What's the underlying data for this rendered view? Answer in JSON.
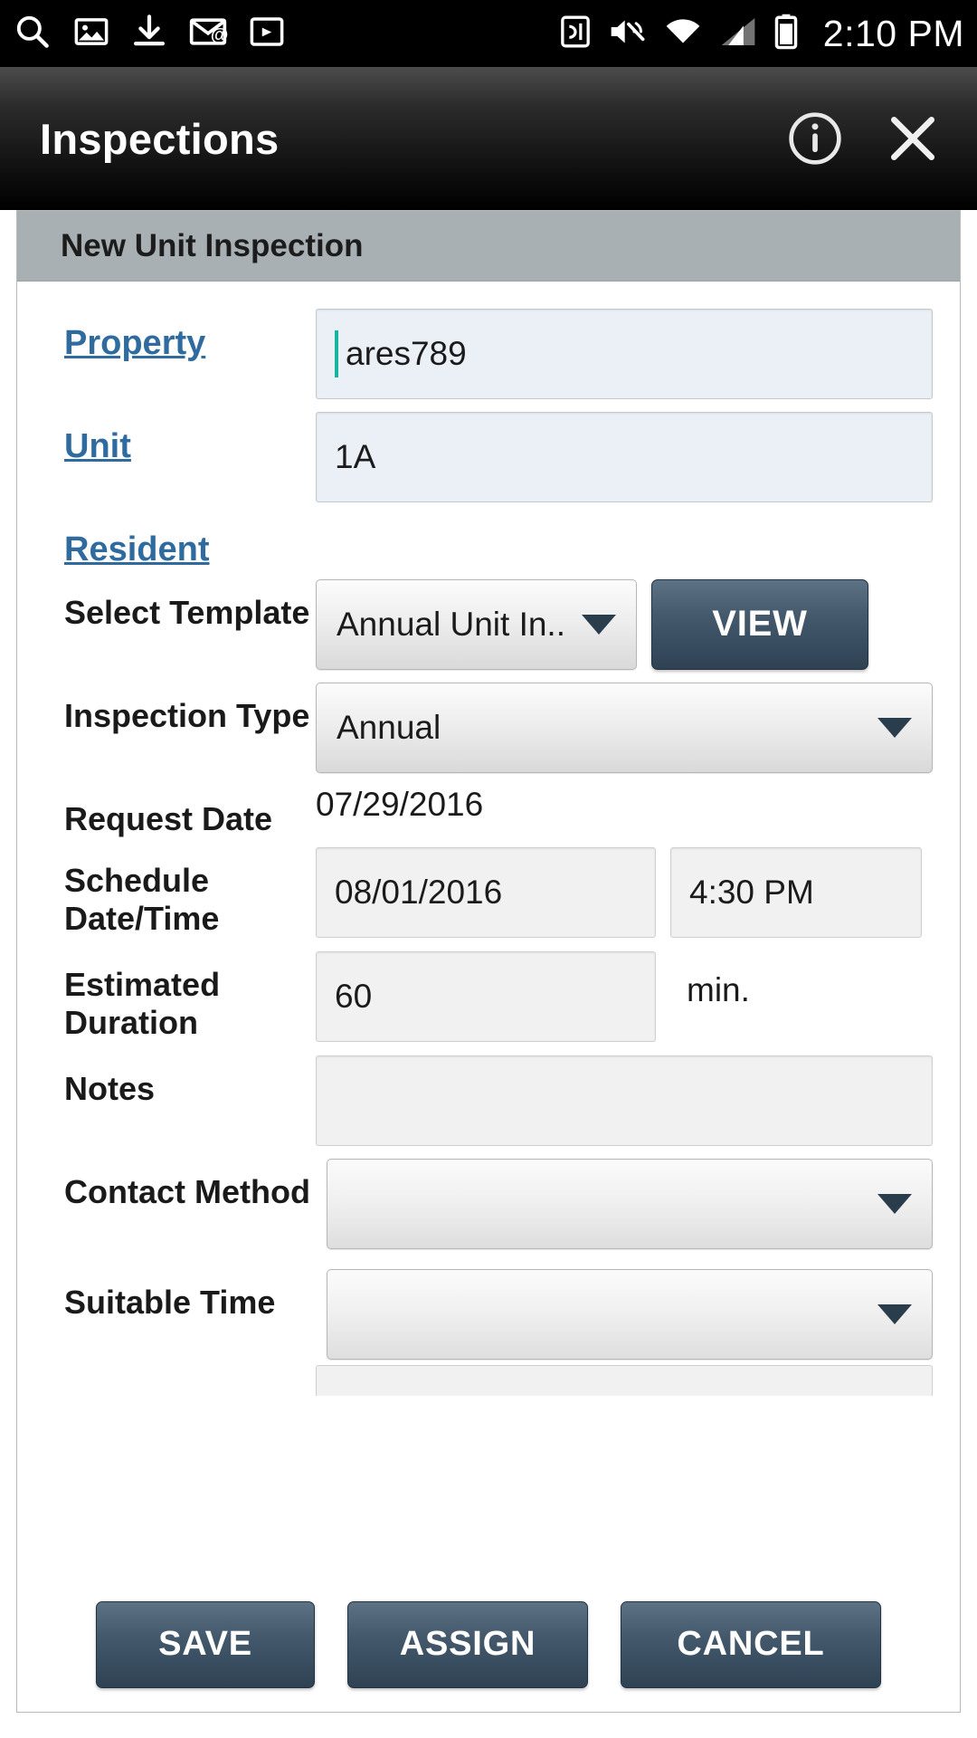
{
  "status_bar": {
    "icons_left": [
      "search-icon",
      "photo-icon",
      "download-icon",
      "email-icon",
      "app-install-icon"
    ],
    "icons_right": [
      "nfc-icon",
      "mute-icon",
      "wifi-icon",
      "signal-icon",
      "battery-icon"
    ],
    "time": "2:10 PM"
  },
  "title_bar": {
    "title": "Inspections",
    "info_icon": "info-icon",
    "close_icon": "close-icon"
  },
  "panel": {
    "header": "New Unit Inspection"
  },
  "form": {
    "property": {
      "label": "Property",
      "value": "ares789",
      "placeholder": ""
    },
    "unit": {
      "label": "Unit",
      "value": "1A",
      "placeholder": ""
    },
    "resident": {
      "label": "Resident"
    },
    "select_template": {
      "label": "Select Template",
      "value": "Annual Unit In..",
      "view_button": "VIEW"
    },
    "inspection_type": {
      "label": "Inspection Type",
      "value": "Annual"
    },
    "request_date": {
      "label": "Request Date",
      "value": "07/29/2016"
    },
    "schedule": {
      "label": "Schedule Date/Time",
      "date": "08/01/2016",
      "time": "4:30 PM"
    },
    "duration": {
      "label": "Estimated Duration",
      "value": "60",
      "unit": "min."
    },
    "notes": {
      "label": "Notes",
      "value": "",
      "placeholder": ""
    },
    "contact_method": {
      "label": "Contact Method",
      "value": ""
    },
    "suitable_time": {
      "label": "Suitable Time",
      "value": ""
    }
  },
  "buttons": {
    "save": "SAVE",
    "assign": "ASSIGN",
    "cancel": "CANCEL"
  },
  "colors": {
    "link": "#2f6b9e",
    "button": "#44596c",
    "header_bar": "#a9b0b4",
    "input_focus_bg": "#eaf0f5",
    "caret": "#15b5a0"
  }
}
